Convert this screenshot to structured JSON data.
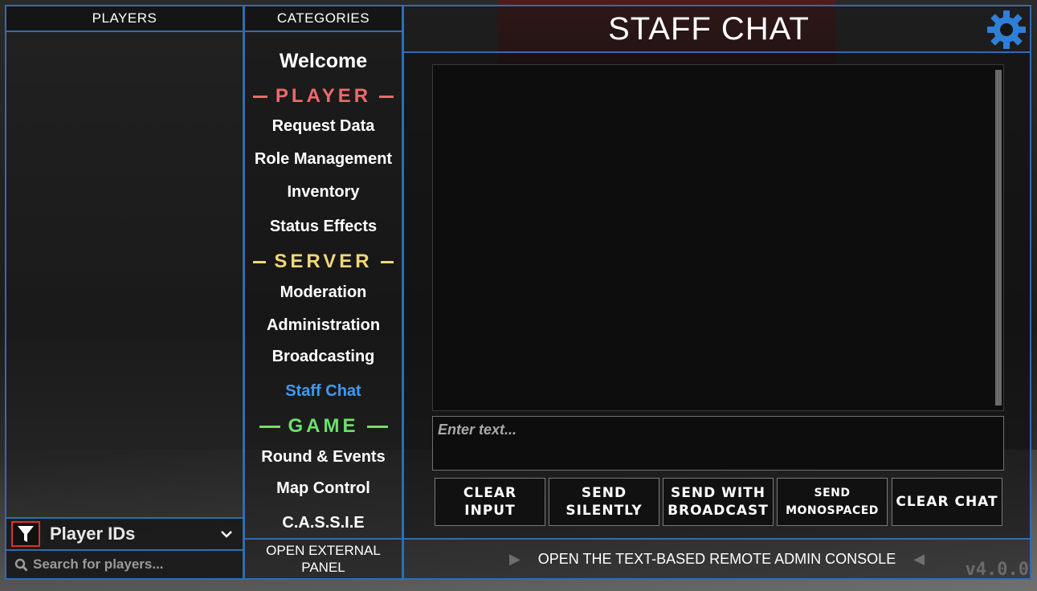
{
  "players_panel": {
    "header": "PLAYERS",
    "filter_label": "Player IDs",
    "search_placeholder": "Search for players..."
  },
  "categories_panel": {
    "header": "CATEGORIES",
    "welcome": "Welcome",
    "sections": [
      {
        "label": "PLAYER",
        "color": "#f06a6a"
      },
      {
        "label": "SERVER",
        "color": "#f0d67a"
      },
      {
        "label": "GAME",
        "color": "#6ee06a"
      }
    ],
    "player_items": [
      "Request Data",
      "Role Management",
      "Inventory",
      "Status Effects"
    ],
    "server_items": [
      "Moderation",
      "Administration",
      "Broadcasting",
      "Staff Chat"
    ],
    "game_items": [
      "Round & Events",
      "Map Control",
      "C.A.S.S.I.E"
    ],
    "active_item": "Staff Chat",
    "external_panel": "OPEN EXTERNAL PANEL"
  },
  "main_panel": {
    "title": "STAFF CHAT",
    "input_placeholder": "Enter text...",
    "buttons": [
      {
        "label": "CLEAR INPUT"
      },
      {
        "label": "SEND SILENTLY"
      },
      {
        "label": "SEND WITH BROADCAST"
      },
      {
        "label": "SEND MONOSPACED"
      },
      {
        "label": "CLEAR CHAT"
      }
    ],
    "console_label": "OPEN THE TEXT-BASED REMOTE ADMIN CONSOLE",
    "version": "v4.0.0"
  },
  "colors": {
    "border": "#2f6db3",
    "active": "#3d9bf5",
    "gear": "#2f7fd6",
    "filter_border": "#e03030"
  },
  "icons": [
    "filter-icon",
    "chevron-down-icon",
    "search-icon",
    "gear-icon",
    "triangle-right-icon",
    "triangle-left-icon"
  ]
}
